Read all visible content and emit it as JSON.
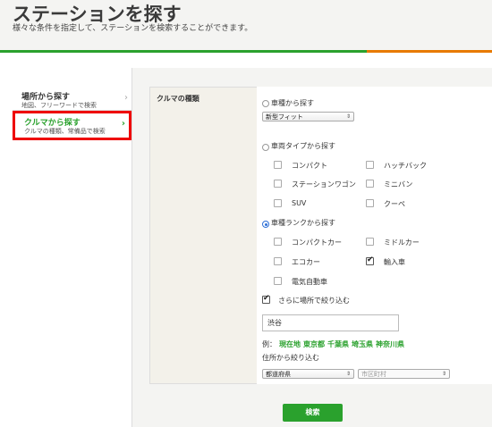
{
  "header": {
    "title": "ステーションを探す",
    "subtitle": "様々な条件を指定して、ステーションを検索することができます。"
  },
  "sidebar": {
    "items": [
      {
        "title": "場所から探す",
        "desc": "地図、フリーワードで検索",
        "arrow": "›",
        "active": false
      },
      {
        "title": "クルマから探す",
        "desc": "クルマの種類、常備品で検索",
        "arrow": "›",
        "active": true
      }
    ]
  },
  "form": {
    "section_label": "クルマの種類",
    "by_model": {
      "label": "車種から探す",
      "selected": false,
      "select_value": "新型フィット"
    },
    "by_type": {
      "label": "車両タイプから探す",
      "selected": false,
      "options": [
        {
          "label": "コンパクト",
          "checked": false
        },
        {
          "label": "ハッチバック",
          "checked": false
        },
        {
          "label": "ステーションワゴン",
          "checked": false
        },
        {
          "label": "ミニバン",
          "checked": false
        },
        {
          "label": "SUV",
          "checked": false
        },
        {
          "label": "クーペ",
          "checked": false
        }
      ]
    },
    "by_rank": {
      "label": "車種ランクから探す",
      "selected": true,
      "options": [
        {
          "label": "コンパクトカー",
          "checked": false
        },
        {
          "label": "ミドルカー",
          "checked": false
        },
        {
          "label": "エコカー",
          "checked": false
        },
        {
          "label": "輸入車",
          "checked": true
        },
        {
          "label": "電気自動車",
          "checked": false
        }
      ]
    },
    "narrow_by_place": {
      "label": "さらに場所で絞り込む",
      "checked": true
    },
    "place_input": "渋谷",
    "examples_label": "例：",
    "examples": [
      "現在地",
      "東京都",
      "千葉県",
      "埼玉県",
      "神奈川県"
    ],
    "address_label": "住所から絞り込む",
    "prefecture_select": "都道府県",
    "city_select": "市区町村"
  },
  "search_button": "検索",
  "colors": {
    "accent": "#2aa12d",
    "highlight_border": "#e00000",
    "orange": "#e87a00"
  }
}
